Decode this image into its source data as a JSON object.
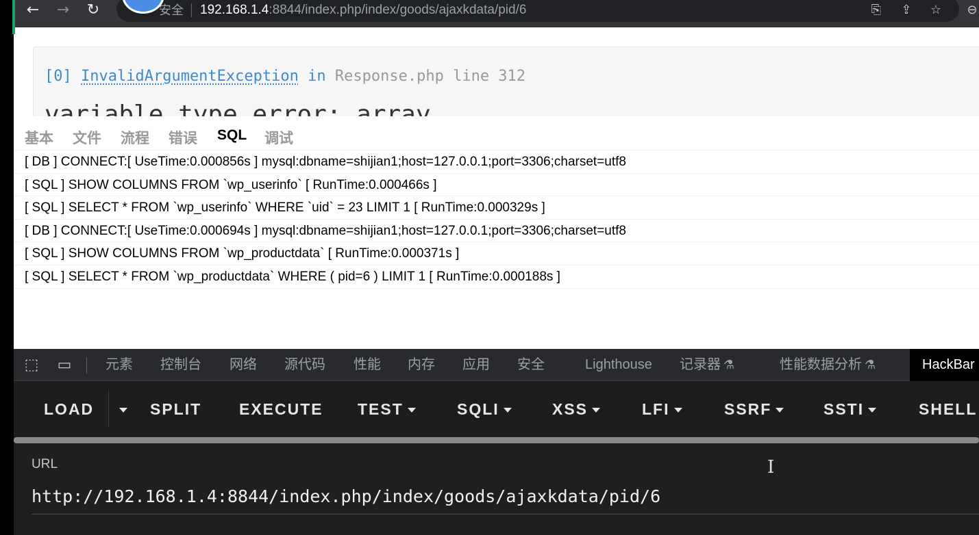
{
  "browser": {
    "security_label": "安全",
    "url_host": "192.168.1.4",
    "url_rest": ":8844/index.php/index/goods/ajaxkdata/pid/6"
  },
  "exception": {
    "index": "[0]",
    "class": "InvalidArgumentException",
    "in_word": "in",
    "location": "Response.php line 312",
    "message_partial": "variable type error:  array"
  },
  "trace_tabs": [
    "基本",
    "文件",
    "流程",
    "错误",
    "SQL",
    "调试"
  ],
  "trace_active_tab": "SQL",
  "sql_log": [
    "[ DB ] CONNECT:[ UseTime:0.000856s ] mysql:dbname=shijian1;host=127.0.0.1;port=3306;charset=utf8",
    "[ SQL ] SHOW COLUMNS FROM `wp_userinfo` [ RunTime:0.000466s ]",
    "[ SQL ] SELECT * FROM `wp_userinfo` WHERE `uid` = 23 LIMIT 1 [ RunTime:0.000329s ]",
    "[ DB ] CONNECT:[ UseTime:0.000694s ] mysql:dbname=shijian1;host=127.0.0.1;port=3306;charset=utf8",
    "[ SQL ] SHOW COLUMNS FROM `wp_productdata` [ RunTime:0.000371s ]",
    "[ SQL ] SELECT * FROM `wp_productdata` WHERE ( pid=6 ) LIMIT 1 [ RunTime:0.000188s ]"
  ],
  "devtools": {
    "tabs": [
      "元素",
      "控制台",
      "网络",
      "源代码",
      "性能",
      "内存",
      "应用",
      "安全",
      "Lighthouse",
      "记录器",
      "性能数据分析",
      "HackBar"
    ],
    "active_tab": "HackBar"
  },
  "hackbar": {
    "buttons": [
      "LOAD",
      "SPLIT",
      "EXECUTE",
      "TEST",
      "SQLI",
      "XSS",
      "LFI",
      "SSRF",
      "SSTI",
      "SHELL"
    ],
    "url_label": "URL",
    "url_value": "http://192.168.1.4:8844/index.php/index/goods/ajaxkdata/pid/6"
  }
}
